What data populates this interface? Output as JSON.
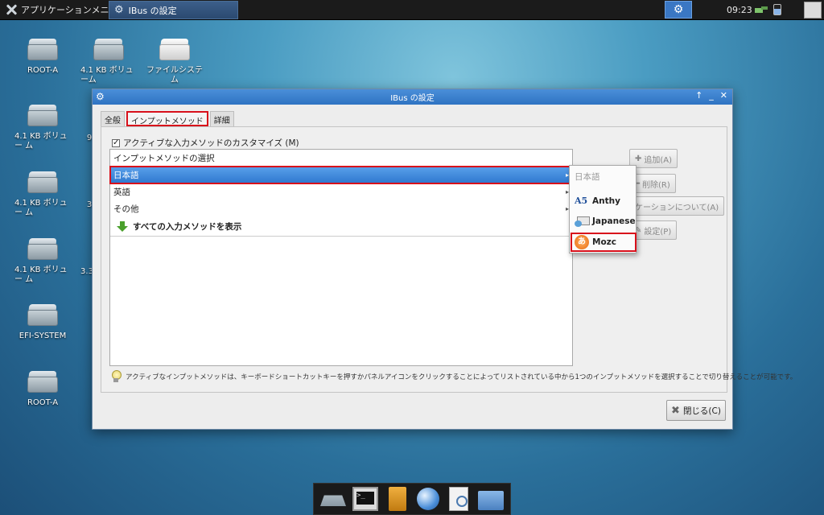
{
  "top_panel": {
    "apps_menu_label": "アプリケーションメニュー",
    "task_title": "IBus の設定",
    "clock": "09:23"
  },
  "desktop_icons": [
    {
      "label": "ROOT-A"
    },
    {
      "label": "4.1 KB ボリューム"
    },
    {
      "label": "ファイルシステム"
    },
    {
      "label": "4.1 KB ボリュー ム"
    },
    {
      "label": "9"
    },
    {
      "label": "4.1 KB ボリュー ム"
    },
    {
      "label": "3"
    },
    {
      "label": "4.1 KB ボリュー ム"
    },
    {
      "label": "3.3"
    },
    {
      "label": "EFI-SYSTEM"
    },
    {
      "label": "ROOT-A"
    }
  ],
  "dialog": {
    "title": "IBus の設定",
    "tabs": [
      "全般",
      "インプットメソッド",
      "詳細"
    ],
    "customize_label": "アクティブな入力メソッドのカスタマイズ (M)",
    "list": {
      "header": "インプットメソッドの選択",
      "items": [
        "日本語",
        "英語",
        "その他"
      ],
      "show_all": "すべての入力メソッドを表示"
    },
    "buttons": {
      "add": "追加(A)",
      "remove": "削除(R)",
      "about": "ケーションについて(A)",
      "preferences": "設定(P)",
      "close": "閉じる(C)"
    },
    "hint": "アクティブなインプットメソッドは、キーボードショートカットキーを押すかパネルアイコンをクリックすることによってリストされている中から1つのインプットメソッドを選択することで切り替えることが可能です。"
  },
  "submenu": {
    "header": "日本語",
    "items": [
      "Anthy",
      "Japanese",
      "Mozc"
    ]
  },
  "colors": {
    "highlight_red": "#d8101b",
    "selection_blue": "#2e78cf",
    "titlebar_blue": "#2f73c2"
  }
}
